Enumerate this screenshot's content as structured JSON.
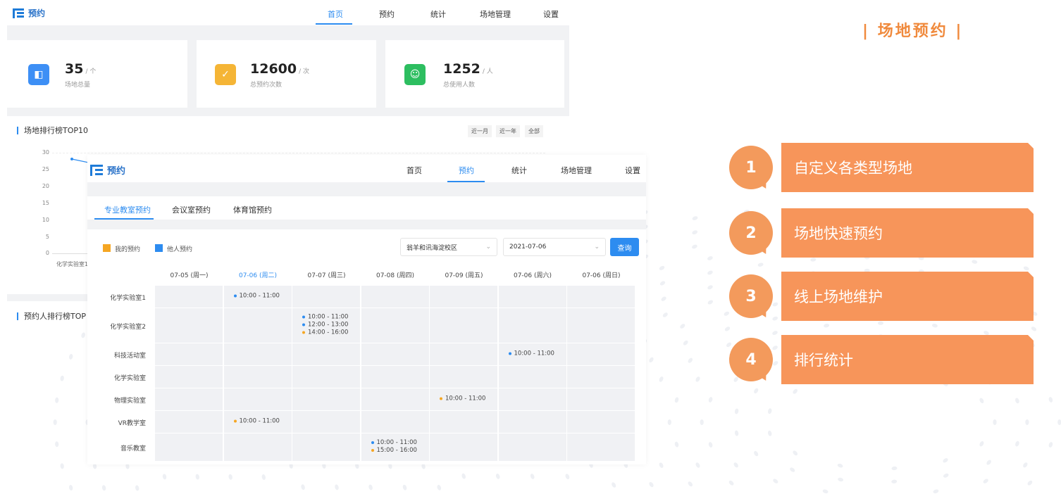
{
  "banner": {
    "title": "| 场地预约 |"
  },
  "app": {
    "name": "预约"
  },
  "back_nav": [
    "首页",
    "预约",
    "统计",
    "场地管理",
    "设置"
  ],
  "stats": [
    {
      "value": "35",
      "unit": "/ 个",
      "label": "场地总量",
      "color": "#3d8ff5",
      "icon": "building-icon"
    },
    {
      "value": "12600",
      "unit": "/ 次",
      "label": "总预约次数",
      "color": "#f5b536",
      "icon": "check-circle-icon"
    },
    {
      "value": "1252",
      "unit": "/ 人",
      "label": "总使用人数",
      "color": "#2dbe60",
      "icon": "user-icon"
    }
  ],
  "ranking": {
    "title": "场地排行榜TOP10",
    "ranges": [
      "近一月",
      "近一年",
      "全部"
    ],
    "yticks": [
      "30",
      "25",
      "20",
      "15",
      "10",
      "5",
      "0"
    ],
    "xcat": "化学实验室1"
  },
  "booker_ranking": {
    "title": "预约人排行榜TOP"
  },
  "front_nav": [
    "首页",
    "预约",
    "统计",
    "场地管理",
    "设置"
  ],
  "tabs": [
    "专业教室预约",
    "会议室预约",
    "体育馆预约"
  ],
  "legend": [
    {
      "label": "我的预约",
      "color": "#f5a623"
    },
    {
      "label": "他人预约",
      "color": "#2d8cf0"
    }
  ],
  "filters": {
    "campus": "翁羊和讯海淀校区",
    "date": "2021-07-06",
    "query": "查询"
  },
  "days": [
    "07-05 (周一)",
    "07-06 (周二)",
    "07-07 (周三)",
    "07-08 (周四)",
    "07-09 (周五)",
    "07-06 (周六)",
    "07-06 (周日)"
  ],
  "rooms": [
    "化学实验室1",
    "化学实验室2",
    "科技活动室",
    "化学实验室",
    "物理实验室",
    "VR教学室",
    "音乐教室"
  ],
  "bookings": [
    {
      "room": 0,
      "day": 1,
      "slots": [
        {
          "t": "10:00 - 11:00",
          "c": "#2d8cf0"
        }
      ]
    },
    {
      "room": 1,
      "day": 2,
      "slots": [
        {
          "t": "10:00 - 11:00",
          "c": "#2d8cf0"
        },
        {
          "t": "12:00 - 13:00",
          "c": "#2d8cf0"
        },
        {
          "t": "14:00 - 16:00",
          "c": "#f5a623"
        }
      ]
    },
    {
      "room": 2,
      "day": 5,
      "slots": [
        {
          "t": "10:00 - 11:00",
          "c": "#2d8cf0"
        }
      ]
    },
    {
      "room": 4,
      "day": 4,
      "slots": [
        {
          "t": "10:00 - 11:00",
          "c": "#f5a623"
        }
      ]
    },
    {
      "room": 5,
      "day": 1,
      "slots": [
        {
          "t": "10:00 - 11:00",
          "c": "#f5a623"
        }
      ]
    },
    {
      "room": 6,
      "day": 3,
      "slots": [
        {
          "t": "10:00 - 11:00",
          "c": "#2d8cf0"
        },
        {
          "t": "15:00 - 16:00",
          "c": "#f5a623"
        }
      ]
    }
  ],
  "features": [
    {
      "num": "1",
      "text": "自定义各类型场地"
    },
    {
      "num": "2",
      "text": "场地快速预约"
    },
    {
      "num": "3",
      "text": "线上场地维护"
    },
    {
      "num": "4",
      "text": "排行统计"
    }
  ]
}
